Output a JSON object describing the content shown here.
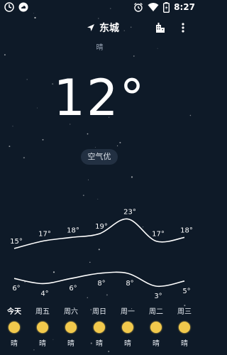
{
  "status_bar": {
    "time": "8:27",
    "icons_left": [
      "alarm-app-icon",
      "cloud-notification-icon"
    ],
    "icons_right": [
      "alarm-icon",
      "wifi-icon",
      "battery-icon"
    ]
  },
  "header": {
    "location_icon": "location-arrow-icon",
    "city": "东城",
    "city_list_icon": "city-buildings-icon",
    "more_icon": "more-vertical-icon"
  },
  "current": {
    "condition": "晴",
    "temperature": "12°",
    "air_quality": "空气优"
  },
  "forecast": {
    "highs": [
      "15°",
      "17°",
      "18°",
      "19°",
      "23°",
      "17°",
      "18°"
    ],
    "high_values": [
      15,
      17,
      18,
      19,
      23,
      17,
      18
    ],
    "lows": [
      "6°",
      "4°",
      "6°",
      "8°",
      "8°",
      "3°",
      "5°"
    ],
    "low_values": [
      6,
      4,
      6,
      8,
      8,
      3,
      5
    ],
    "days": [
      {
        "name": "今天",
        "condition": "晴",
        "icon": "sun-icon"
      },
      {
        "name": "周五",
        "condition": "晴",
        "icon": "sun-icon"
      },
      {
        "name": "周六",
        "condition": "晴",
        "icon": "sun-icon"
      },
      {
        "name": "周日",
        "condition": "晴",
        "icon": "sun-icon"
      },
      {
        "name": "周一",
        "condition": "晴",
        "icon": "sun-icon"
      },
      {
        "name": "周二",
        "condition": "晴",
        "icon": "sun-icon"
      },
      {
        "name": "周三",
        "condition": "晴",
        "icon": "sun-icon"
      }
    ]
  },
  "colors": {
    "background": "#0e1a28",
    "sun": "#f2c94c",
    "text": "#ffffff"
  }
}
